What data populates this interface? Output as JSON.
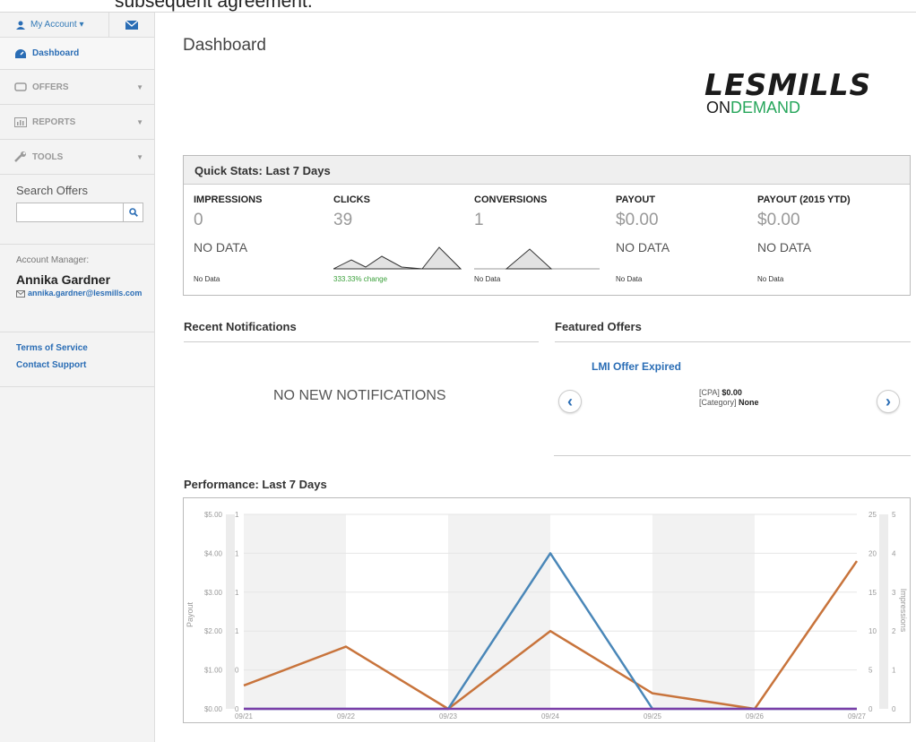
{
  "banner_text": "subsequent agreement.",
  "sidebar": {
    "account_label": "My Account ▾",
    "nav": [
      {
        "label": "Dashboard"
      },
      {
        "label": "OFFERS"
      },
      {
        "label": "REPORTS"
      },
      {
        "label": "TOOLS"
      }
    ],
    "search_label": "Search Offers",
    "search_value": "",
    "manager_label": "Account Manager:",
    "manager_name": "Annika Gardner",
    "manager_email": "annika.gardner@lesmills.com",
    "links": [
      "Terms of Service",
      "Contact Support"
    ]
  },
  "main": {
    "title": "Dashboard",
    "logo": {
      "line1": "LESMILLS",
      "line2a": "ON",
      "line2b": "DEMAND"
    },
    "quick_stats": {
      "title": "Quick Stats: Last 7 Days",
      "columns": [
        {
          "header": "IMPRESSIONS",
          "value": "0",
          "sub": "NO DATA",
          "foot": "No Data"
        },
        {
          "header": "CLICKS",
          "value": "39",
          "sub": "",
          "foot": "333.33% change"
        },
        {
          "header": "CONVERSIONS",
          "value": "1",
          "sub": "",
          "foot": "No Data"
        },
        {
          "header": "PAYOUT",
          "value": "$0.00",
          "sub": "NO DATA",
          "foot": "No Data"
        },
        {
          "header": "PAYOUT (2015 YTD)",
          "value": "$0.00",
          "sub": "NO DATA",
          "foot": "No Data"
        }
      ]
    },
    "notifications": {
      "title": "Recent Notifications",
      "empty": "NO NEW NOTIFICATIONS"
    },
    "featured": {
      "title": "Featured Offers",
      "offer_name": "LMI Offer Expired",
      "cpa_label": "[CPA]",
      "cpa_value": "$0.00",
      "category_label": "[Category]",
      "category_value": "None"
    },
    "performance": {
      "title": "Performance: Last 7 Days"
    }
  },
  "colors": {
    "accent": "#2a6db5",
    "orange": "#c8743c",
    "blue": "#4a87b8",
    "purple": "#7b3fa8",
    "green": "#3aa03a"
  },
  "chart_data": {
    "type": "line",
    "x": [
      "09/21",
      "09/22",
      "09/23",
      "09/24",
      "09/25",
      "09/26",
      "09/27"
    ],
    "axes": {
      "payout": {
        "label": "Payout",
        "ticks": [
          "$0.00",
          "$1.00",
          "$2.00",
          "$3.00",
          "$4.00",
          "$5.00"
        ],
        "ylim": [
          0,
          5
        ]
      },
      "conversions": {
        "ticks": [
          "0",
          "0",
          "1",
          "1",
          "1",
          "1"
        ]
      },
      "clicks": {
        "ticks": [
          "0",
          "5",
          "10",
          "15",
          "20",
          "25"
        ],
        "ylim": [
          0,
          25
        ]
      },
      "impressions": {
        "label": "Impressions",
        "ticks": [
          "0",
          "1",
          "2",
          "3",
          "4",
          "5"
        ],
        "ylim": [
          0,
          5
        ]
      }
    },
    "series": [
      {
        "color": "#c8743c",
        "axis": "clicks",
        "values": [
          3,
          8,
          0,
          10,
          2,
          0,
          19
        ]
      },
      {
        "color": "#4a87b8",
        "axis": "conversions_scale",
        "values": [
          0,
          0,
          0,
          4,
          0,
          0,
          0
        ]
      },
      {
        "color": "#7b3fa8",
        "axis": "impressions",
        "values": [
          0,
          0,
          0,
          0,
          0,
          0,
          0
        ]
      }
    ]
  }
}
